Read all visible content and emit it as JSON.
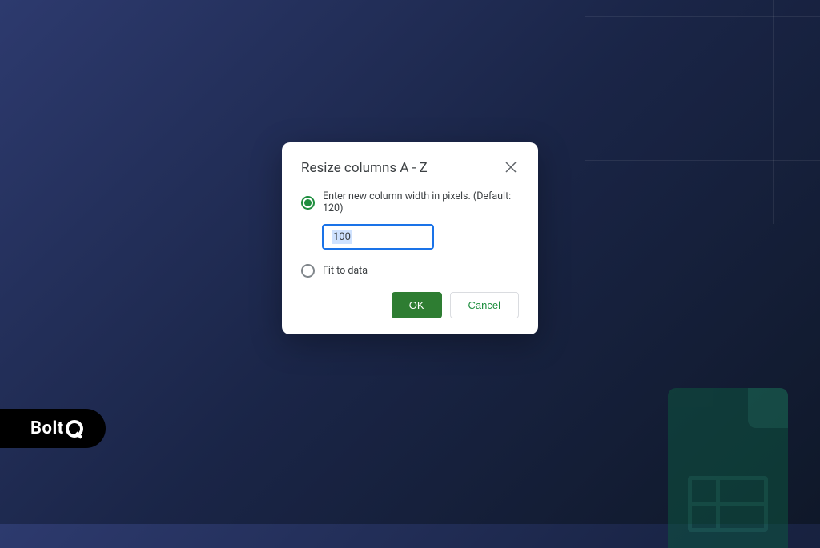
{
  "dialog": {
    "title": "Resize columns A - Z",
    "options": {
      "custom_width": {
        "label": "Enter new column width in pixels. (Default: 120)",
        "selected": true,
        "value": "100"
      },
      "fit_to_data": {
        "label": "Fit to data",
        "selected": false
      }
    },
    "actions": {
      "ok": "OK",
      "cancel": "Cancel"
    }
  },
  "brand": {
    "name": "Bolt"
  }
}
